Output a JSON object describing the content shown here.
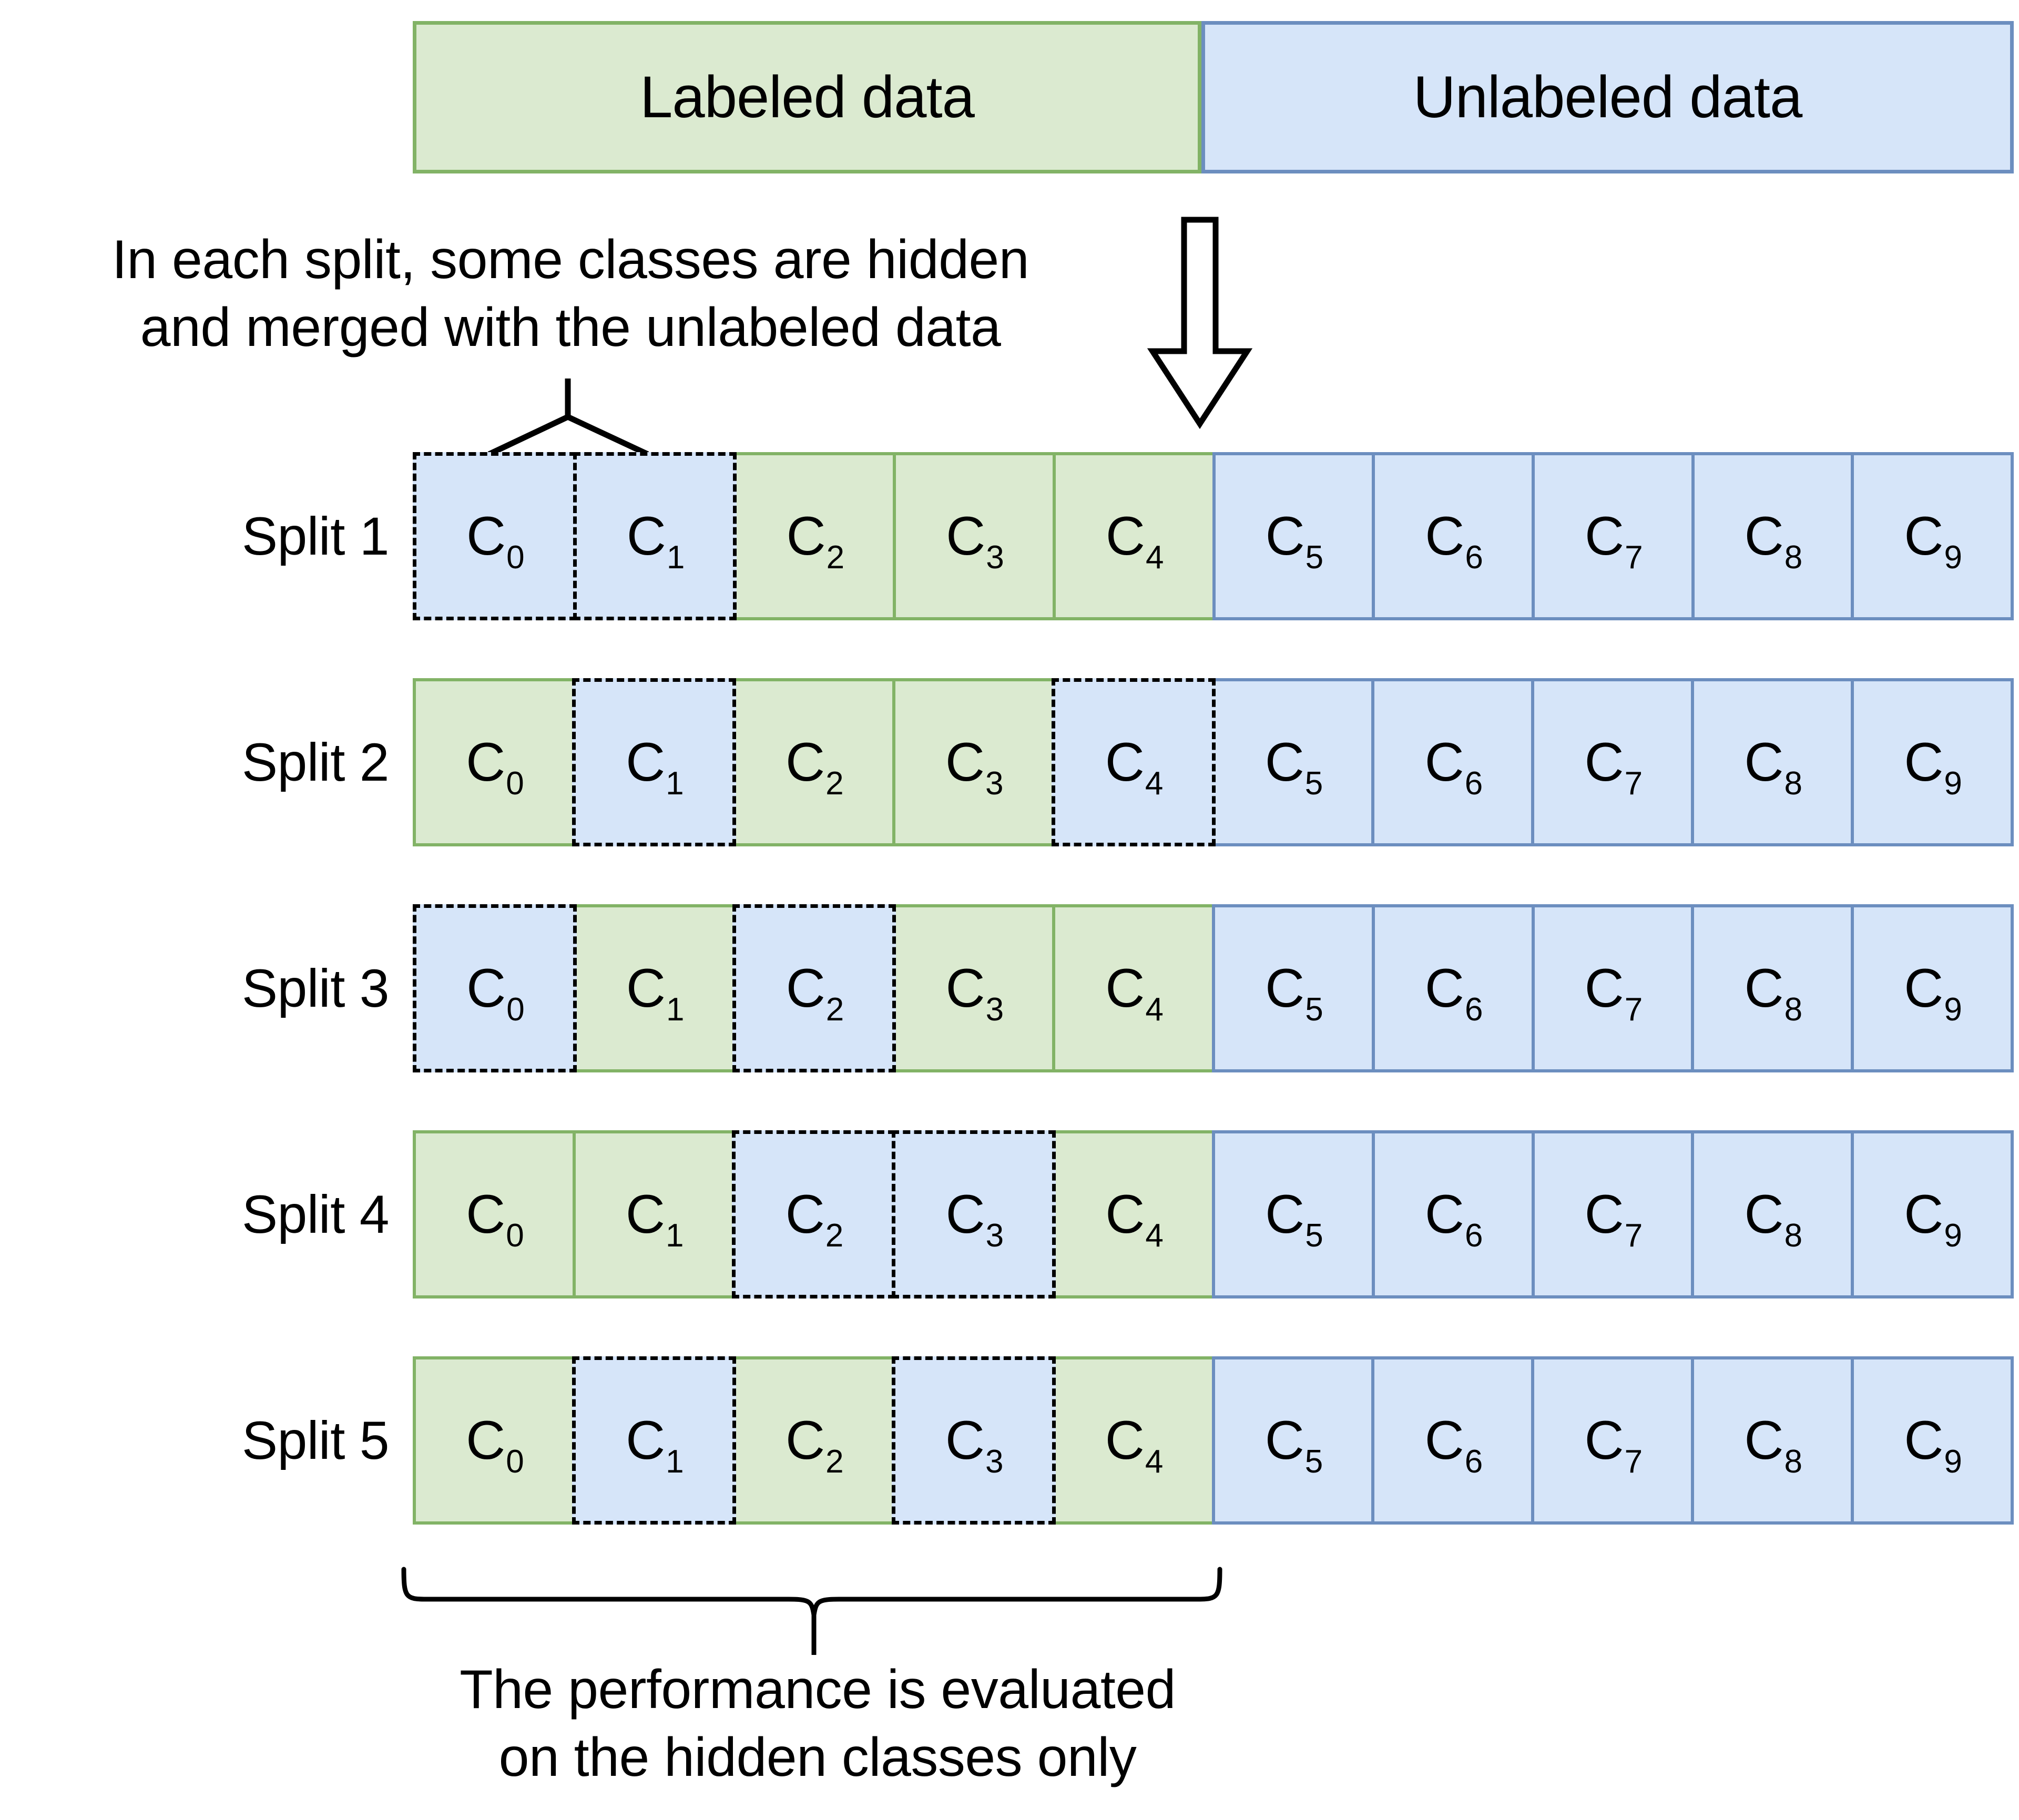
{
  "legend": {
    "labeled": "Labeled data",
    "unlabeled": "Unlabeled data"
  },
  "annotations": {
    "hidden_note_line1": "In each split, some classes are hidden",
    "hidden_note_line2": "and merged with the unlabeled data",
    "eval_note_line1": "The performance is evaluated",
    "eval_note_line2": "on the hidden classes only"
  },
  "class_names": [
    "C",
    "C",
    "C",
    "C",
    "C",
    "C",
    "C",
    "C",
    "C",
    "C"
  ],
  "class_subscripts": [
    "0",
    "1",
    "2",
    "3",
    "4",
    "5",
    "6",
    "7",
    "8",
    "9"
  ],
  "colors": {
    "labeled_fill": "#dbead0",
    "labeled_border": "#82b366",
    "unlabeled_fill": "#d6e5f9",
    "unlabeled_border": "#6c8ebf",
    "hidden_border": "#000000",
    "line": "#000000"
  },
  "splits": [
    {
      "label": "Split 1",
      "cells": [
        {
          "name": "C",
          "sub": "0",
          "state": "hidden"
        },
        {
          "name": "C",
          "sub": "1",
          "state": "hidden"
        },
        {
          "name": "C",
          "sub": "2",
          "state": "labeled"
        },
        {
          "name": "C",
          "sub": "3",
          "state": "labeled"
        },
        {
          "name": "C",
          "sub": "4",
          "state": "labeled"
        },
        {
          "name": "C",
          "sub": "5",
          "state": "unlabeled"
        },
        {
          "name": "C",
          "sub": "6",
          "state": "unlabeled"
        },
        {
          "name": "C",
          "sub": "7",
          "state": "unlabeled"
        },
        {
          "name": "C",
          "sub": "8",
          "state": "unlabeled"
        },
        {
          "name": "C",
          "sub": "9",
          "state": "unlabeled"
        }
      ]
    },
    {
      "label": "Split 2",
      "cells": [
        {
          "name": "C",
          "sub": "0",
          "state": "labeled"
        },
        {
          "name": "C",
          "sub": "1",
          "state": "hidden"
        },
        {
          "name": "C",
          "sub": "2",
          "state": "labeled"
        },
        {
          "name": "C",
          "sub": "3",
          "state": "labeled"
        },
        {
          "name": "C",
          "sub": "4",
          "state": "hidden"
        },
        {
          "name": "C",
          "sub": "5",
          "state": "unlabeled"
        },
        {
          "name": "C",
          "sub": "6",
          "state": "unlabeled"
        },
        {
          "name": "C",
          "sub": "7",
          "state": "unlabeled"
        },
        {
          "name": "C",
          "sub": "8",
          "state": "unlabeled"
        },
        {
          "name": "C",
          "sub": "9",
          "state": "unlabeled"
        }
      ]
    },
    {
      "label": "Split 3",
      "cells": [
        {
          "name": "C",
          "sub": "0",
          "state": "hidden"
        },
        {
          "name": "C",
          "sub": "1",
          "state": "labeled"
        },
        {
          "name": "C",
          "sub": "2",
          "state": "hidden"
        },
        {
          "name": "C",
          "sub": "3",
          "state": "labeled"
        },
        {
          "name": "C",
          "sub": "4",
          "state": "labeled"
        },
        {
          "name": "C",
          "sub": "5",
          "state": "unlabeled"
        },
        {
          "name": "C",
          "sub": "6",
          "state": "unlabeled"
        },
        {
          "name": "C",
          "sub": "7",
          "state": "unlabeled"
        },
        {
          "name": "C",
          "sub": "8",
          "state": "unlabeled"
        },
        {
          "name": "C",
          "sub": "9",
          "state": "unlabeled"
        }
      ]
    },
    {
      "label": "Split 4",
      "cells": [
        {
          "name": "C",
          "sub": "0",
          "state": "labeled"
        },
        {
          "name": "C",
          "sub": "1",
          "state": "labeled"
        },
        {
          "name": "C",
          "sub": "2",
          "state": "hidden"
        },
        {
          "name": "C",
          "sub": "3",
          "state": "hidden"
        },
        {
          "name": "C",
          "sub": "4",
          "state": "labeled"
        },
        {
          "name": "C",
          "sub": "5",
          "state": "unlabeled"
        },
        {
          "name": "C",
          "sub": "6",
          "state": "unlabeled"
        },
        {
          "name": "C",
          "sub": "7",
          "state": "unlabeled"
        },
        {
          "name": "C",
          "sub": "8",
          "state": "unlabeled"
        },
        {
          "name": "C",
          "sub": "9",
          "state": "unlabeled"
        }
      ]
    },
    {
      "label": "Split 5",
      "cells": [
        {
          "name": "C",
          "sub": "0",
          "state": "labeled"
        },
        {
          "name": "C",
          "sub": "1",
          "state": "hidden"
        },
        {
          "name": "C",
          "sub": "2",
          "state": "labeled"
        },
        {
          "name": "C",
          "sub": "3",
          "state": "hidden"
        },
        {
          "name": "C",
          "sub": "4",
          "state": "labeled"
        },
        {
          "name": "C",
          "sub": "5",
          "state": "unlabeled"
        },
        {
          "name": "C",
          "sub": "6",
          "state": "unlabeled"
        },
        {
          "name": "C",
          "sub": "7",
          "state": "unlabeled"
        },
        {
          "name": "C",
          "sub": "8",
          "state": "unlabeled"
        },
        {
          "name": "C",
          "sub": "9",
          "state": "unlabeled"
        }
      ]
    }
  ]
}
